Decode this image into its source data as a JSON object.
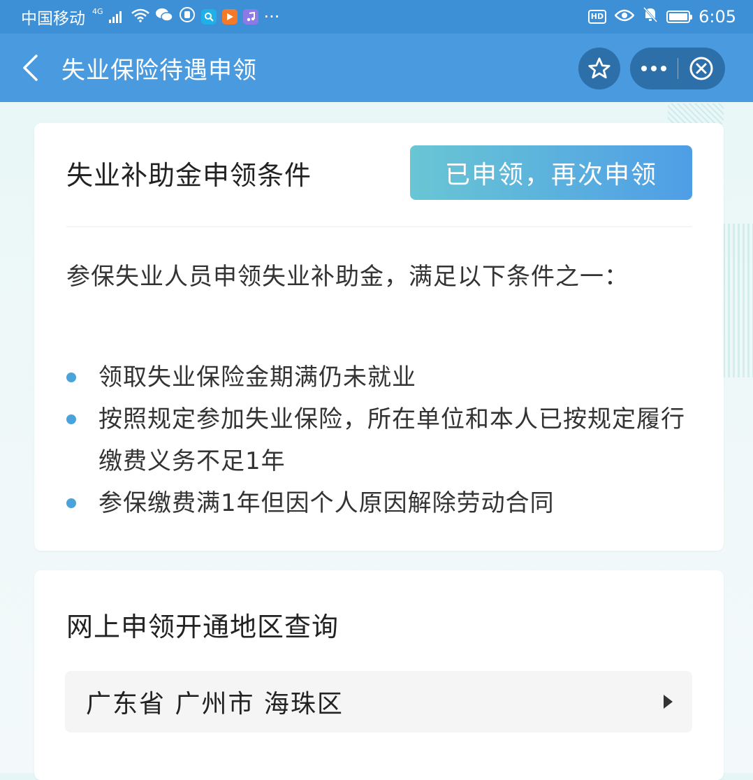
{
  "status_bar": {
    "carrier": "中国移动",
    "network": "4G",
    "hd_label": "HD",
    "time": "6:05",
    "overflow": "···"
  },
  "nav": {
    "title": "失业保险待遇申领"
  },
  "conditions_card": {
    "title": "失业补助金申领条件",
    "reapply_label": "已申领，再次申领",
    "intro": "参保失业人员申领失业补助金，满足以下条件之一：",
    "items": [
      "领取失业保险金期满仍未就业",
      "按照规定参加失业保险，所在单位和本人已按规定履行缴费义务不足1年",
      "参保缴费满1年但因个人原因解除劳动合同"
    ]
  },
  "region_card": {
    "title": "网上申领开通地区查询",
    "selected_region": "广东省 广州市 海珠区"
  },
  "colors": {
    "nav_bg": "#4a9ae0",
    "status_bg": "#3d8fd6",
    "button_gradient_start": "#69c6d4",
    "button_gradient_end": "#4e9ee6",
    "bullet": "#4aa3db"
  }
}
